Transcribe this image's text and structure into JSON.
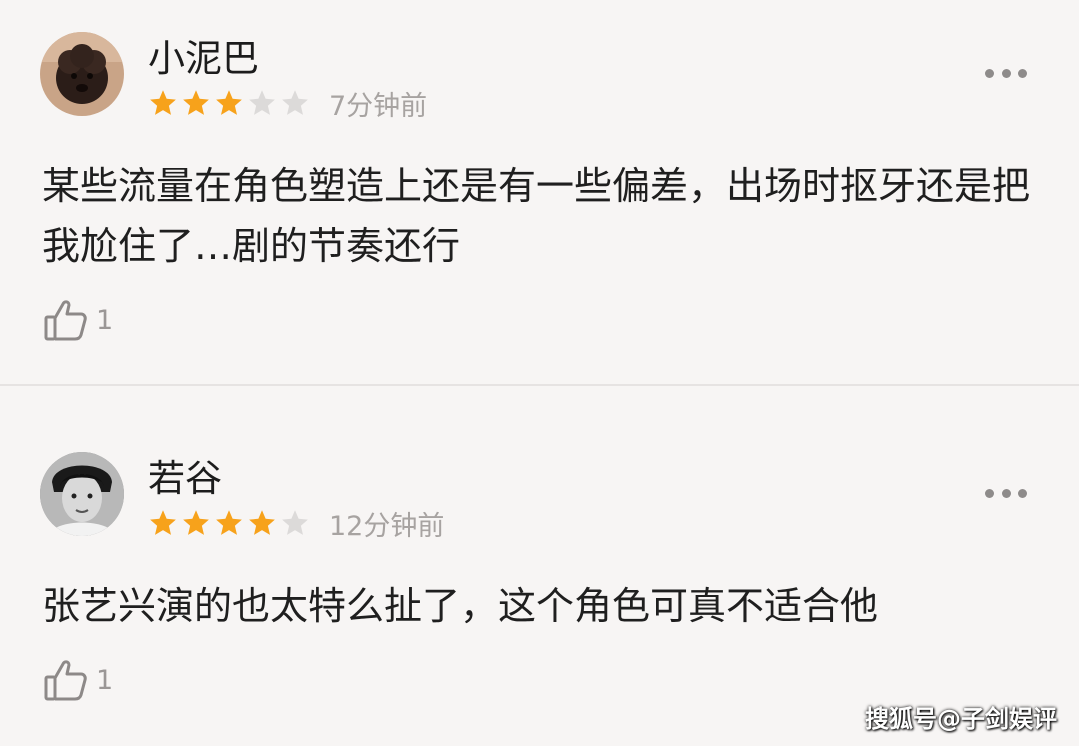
{
  "comments": [
    {
      "username": "小泥巴",
      "rating": 3,
      "max_rating": 5,
      "time": "7分钟前",
      "text": "某些流量在角色塑造上还是有一些偏差，出场时抠牙还是把我尬住了…剧的节奏还行",
      "likes": "1"
    },
    {
      "username": "若谷",
      "rating": 4,
      "max_rating": 5,
      "time": "12分钟前",
      "text": "张艺兴演的也太特么扯了，这个角色可真不适合他",
      "likes": "1"
    }
  ],
  "watermark": "搜狐号@子剑娱评",
  "colors": {
    "star_filled": "#f7a21b",
    "star_empty": "#dcdad9",
    "background": "#f7f5f4"
  }
}
